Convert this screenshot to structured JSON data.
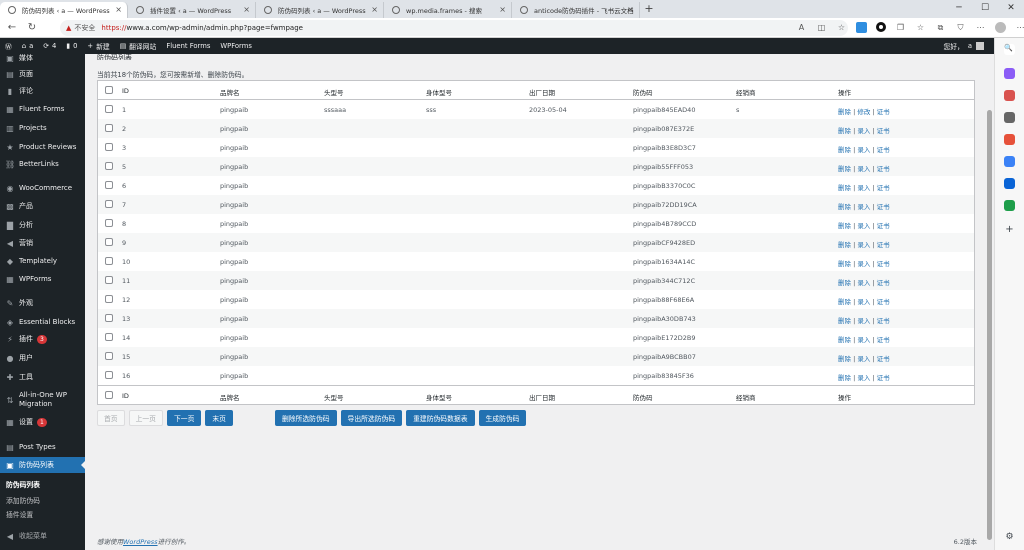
{
  "browser": {
    "tabs": [
      {
        "title": "防伪码列表 ‹ a — WordPress",
        "active": true
      },
      {
        "title": "插件设置 ‹ a — WordPress",
        "active": false
      },
      {
        "title": "防伪码列表 ‹ a — WordPress",
        "active": false
      },
      {
        "title": "wp.media.frames - 搜索",
        "active": false
      },
      {
        "title": "anticode防伪码插件 - 飞书云文档",
        "active": false
      }
    ],
    "security_warning": "不安全",
    "url_scheme": "https://",
    "url_rest": "www.a.com/wp-admin/admin.php?page=fwmpage"
  },
  "adminbar": {
    "site": "a",
    "updates": "4",
    "comments": "0",
    "new": "新建",
    "translate": "翻译网站",
    "fluent_forms": "Fluent Forms",
    "wpforms": "WPForms",
    "greeting": "您好，",
    "user": "a"
  },
  "sidebar": {
    "items": [
      {
        "label": "媒体",
        "icon": "media-icon"
      },
      {
        "label": "页面",
        "icon": "page-icon"
      },
      {
        "label": "评论",
        "icon": "comment-icon"
      },
      {
        "label": "Fluent Forms",
        "icon": "form-icon"
      },
      {
        "label": "Projects",
        "icon": "folder-icon"
      },
      {
        "label": "Product Reviews",
        "icon": "star-icon"
      },
      {
        "label": "BetterLinks",
        "icon": "link-icon"
      },
      {
        "label": "WooCommerce",
        "icon": "woo-icon"
      },
      {
        "label": "产品",
        "icon": "box-icon"
      },
      {
        "label": "分析",
        "icon": "chart-icon"
      },
      {
        "label": "营销",
        "icon": "megaphone-icon"
      },
      {
        "label": "Templately",
        "icon": "templately-icon"
      },
      {
        "label": "WPForms",
        "icon": "wpforms-icon"
      },
      {
        "label": "外观",
        "icon": "brush-icon"
      },
      {
        "label": "Essential Blocks",
        "icon": "blocks-icon"
      },
      {
        "label": "插件",
        "icon": "plugin-icon",
        "badge": "3"
      },
      {
        "label": "用户",
        "icon": "user-icon"
      },
      {
        "label": "工具",
        "icon": "wrench-icon"
      },
      {
        "label": "All-in-One WP",
        "label2": "Migration",
        "icon": "migration-icon"
      },
      {
        "label": "设置",
        "icon": "settings-icon",
        "badge": "1"
      },
      {
        "label": "Post Types",
        "icon": "posttypes-icon"
      },
      {
        "label": "防伪码列表",
        "icon": "shield-icon",
        "current": true
      }
    ],
    "submenu": [
      "防伪码列表",
      "添加防伪码",
      "插件设置"
    ],
    "collapse": "收起菜单"
  },
  "page": {
    "title": "防伪码列表",
    "total_text": "当前共18个防伪码，您可按需新增、删除防伪码。",
    "columns": [
      "ID",
      "品牌名",
      "头型号",
      "身体型号",
      "出厂日期",
      "防伪码",
      "经销商",
      "操作"
    ],
    "rows": [
      {
        "id": "1",
        "brand": "pingpaib",
        "head": "sssaaa",
        "body": "sss",
        "date": "2023-05-04",
        "code": "pingpaib845EAD40",
        "dealer": "s",
        "actions": [
          "删除",
          "修改",
          "证书"
        ]
      },
      {
        "id": "2",
        "brand": "pingpaib",
        "head": "",
        "body": "",
        "date": "",
        "code": "pingpaib087E372E",
        "dealer": "",
        "actions": [
          "删除",
          "录入",
          "证书"
        ]
      },
      {
        "id": "3",
        "brand": "pingpaib",
        "head": "",
        "body": "",
        "date": "",
        "code": "pingpaibB3E8D3C7",
        "dealer": "",
        "actions": [
          "删除",
          "录入",
          "证书"
        ]
      },
      {
        "id": "5",
        "brand": "pingpaib",
        "head": "",
        "body": "",
        "date": "",
        "code": "pingpaib55FFF053",
        "dealer": "",
        "actions": [
          "删除",
          "录入",
          "证书"
        ]
      },
      {
        "id": "6",
        "brand": "pingpaib",
        "head": "",
        "body": "",
        "date": "",
        "code": "pingpaibB3370C0C",
        "dealer": "",
        "actions": [
          "删除",
          "录入",
          "证书"
        ]
      },
      {
        "id": "7",
        "brand": "pingpaib",
        "head": "",
        "body": "",
        "date": "",
        "code": "pingpaib72DD19CA",
        "dealer": "",
        "actions": [
          "删除",
          "录入",
          "证书"
        ]
      },
      {
        "id": "8",
        "brand": "pingpaib",
        "head": "",
        "body": "",
        "date": "",
        "code": "pingpaib4B789CCD",
        "dealer": "",
        "actions": [
          "删除",
          "录入",
          "证书"
        ]
      },
      {
        "id": "9",
        "brand": "pingpaib",
        "head": "",
        "body": "",
        "date": "",
        "code": "pingpaibCF9428ED",
        "dealer": "",
        "actions": [
          "删除",
          "录入",
          "证书"
        ]
      },
      {
        "id": "10",
        "brand": "pingpaib",
        "head": "",
        "body": "",
        "date": "",
        "code": "pingpaib1634A14C",
        "dealer": "",
        "actions": [
          "删除",
          "录入",
          "证书"
        ]
      },
      {
        "id": "11",
        "brand": "pingpaib",
        "head": "",
        "body": "",
        "date": "",
        "code": "pingpaib344C712C",
        "dealer": "",
        "actions": [
          "删除",
          "录入",
          "证书"
        ]
      },
      {
        "id": "12",
        "brand": "pingpaib",
        "head": "",
        "body": "",
        "date": "",
        "code": "pingpaib88F68E6A",
        "dealer": "",
        "actions": [
          "删除",
          "录入",
          "证书"
        ]
      },
      {
        "id": "13",
        "brand": "pingpaib",
        "head": "",
        "body": "",
        "date": "",
        "code": "pingpaibA30DB743",
        "dealer": "",
        "actions": [
          "删除",
          "录入",
          "证书"
        ]
      },
      {
        "id": "14",
        "brand": "pingpaib",
        "head": "",
        "body": "",
        "date": "",
        "code": "pingpaibE172D2B9",
        "dealer": "",
        "actions": [
          "删除",
          "录入",
          "证书"
        ]
      },
      {
        "id": "15",
        "brand": "pingpaib",
        "head": "",
        "body": "",
        "date": "",
        "code": "pingpaibA9BCBB07",
        "dealer": "",
        "actions": [
          "删除",
          "录入",
          "证书"
        ]
      },
      {
        "id": "16",
        "brand": "pingpaib",
        "head": "",
        "body": "",
        "date": "",
        "code": "pingpaib83845F36",
        "dealer": "",
        "actions": [
          "删除",
          "录入",
          "证书"
        ]
      }
    ],
    "pager": {
      "first": "首页",
      "prev": "上一页",
      "next": "下一页",
      "last": "末页"
    },
    "bulk": {
      "delete_selected": "删除所选防伪码",
      "export_selected": "导出所选防伪码",
      "rebuild": "重建防伪码数据表",
      "generate": "生成防伪码"
    },
    "footer_pre": "感谢使用",
    "footer_link": "WordPress",
    "footer_post": "进行创作。",
    "version": "6.2版本"
  },
  "colors": {
    "wp_dark": "#1d2327",
    "wp_blue": "#2271b1",
    "badge_red": "#d63638"
  }
}
